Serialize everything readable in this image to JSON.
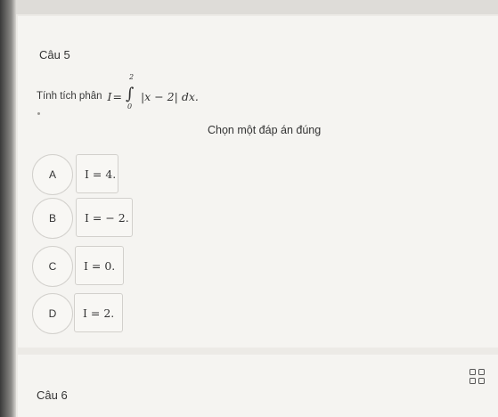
{
  "question": {
    "number_label": "Câu 5",
    "stem_text": "Tính tích phân",
    "formula": {
      "lhs": "I",
      "equals": "=",
      "integral_sign": "∫",
      "upper_limit": "2",
      "lower_limit": "0",
      "integrand": "|x − 2|",
      "differential": "dx."
    },
    "prompt": "Chọn một đáp án đúng",
    "options": [
      {
        "letter": "A",
        "answer": "I = 4."
      },
      {
        "letter": "B",
        "answer": "I = − 2."
      },
      {
        "letter": "C",
        "answer": "I = 0."
      },
      {
        "letter": "D",
        "answer": "I = 2."
      }
    ]
  },
  "next_question": {
    "number_label": "Câu 6"
  },
  "icons": {
    "question_grid": "grid-icon"
  },
  "colors": {
    "background": "#eceae6",
    "card": "#f5f4f1",
    "border": "#d2d0cc",
    "text": "#333333"
  }
}
